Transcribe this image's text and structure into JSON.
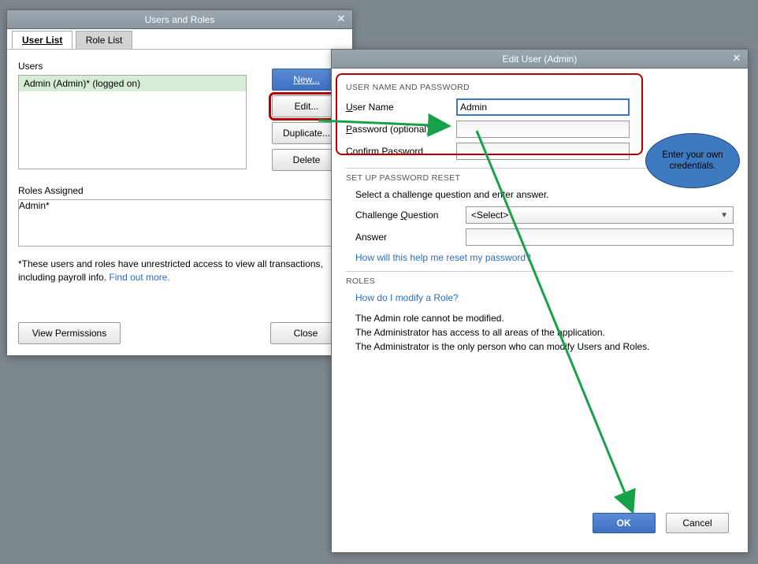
{
  "users_roles": {
    "title": "Users and Roles",
    "tabs": {
      "user_list": "User List",
      "role_list": "Role List"
    },
    "users_label": "Users",
    "listed_user": "Admin (Admin)* (logged on)",
    "buttons": {
      "new": "New...",
      "edit": "Edit...",
      "duplicate": "Duplicate...",
      "delete": "Delete"
    },
    "roles_assigned_label": "Roles Assigned",
    "role_row": "Admin*",
    "footnote_text": "*These users and roles have unrestricted access to view all transactions, including payroll info.  ",
    "footnote_link": "Find out more.",
    "view_permissions": "View Permissions",
    "close": "Close"
  },
  "edit_user": {
    "title": "Edit User (Admin)",
    "section_user_pw": "USER NAME AND PASSWORD",
    "username_label_pre": "U",
    "username_label_rest": "ser Name",
    "username_value": "Admin",
    "password_label_pre": "P",
    "password_label_rest": "assword (optional)",
    "confirm_label": "Confirm Password",
    "section_reset": "SET UP PASSWORD RESET",
    "reset_instr": "Select a challenge question and enter answer.",
    "challenge_label_pre": "Challenge ",
    "challenge_label_u": "Q",
    "challenge_label_rest": "uestion",
    "challenge_placeholder": "<Select>",
    "answer_label": "Answer",
    "reset_help_link": "How will this help me reset my password?",
    "section_roles": "ROLES",
    "roles_link": "How do I modify a Role?",
    "roles_text1": "The Admin role cannot be modified.",
    "roles_text2": "The Administrator has access to all areas of the application.",
    "roles_text3": "The Administrator is the only person who can modify Users and Roles.",
    "ok": "OK",
    "cancel": "Cancel"
  },
  "callout": {
    "text": "Enter your own credentials."
  }
}
